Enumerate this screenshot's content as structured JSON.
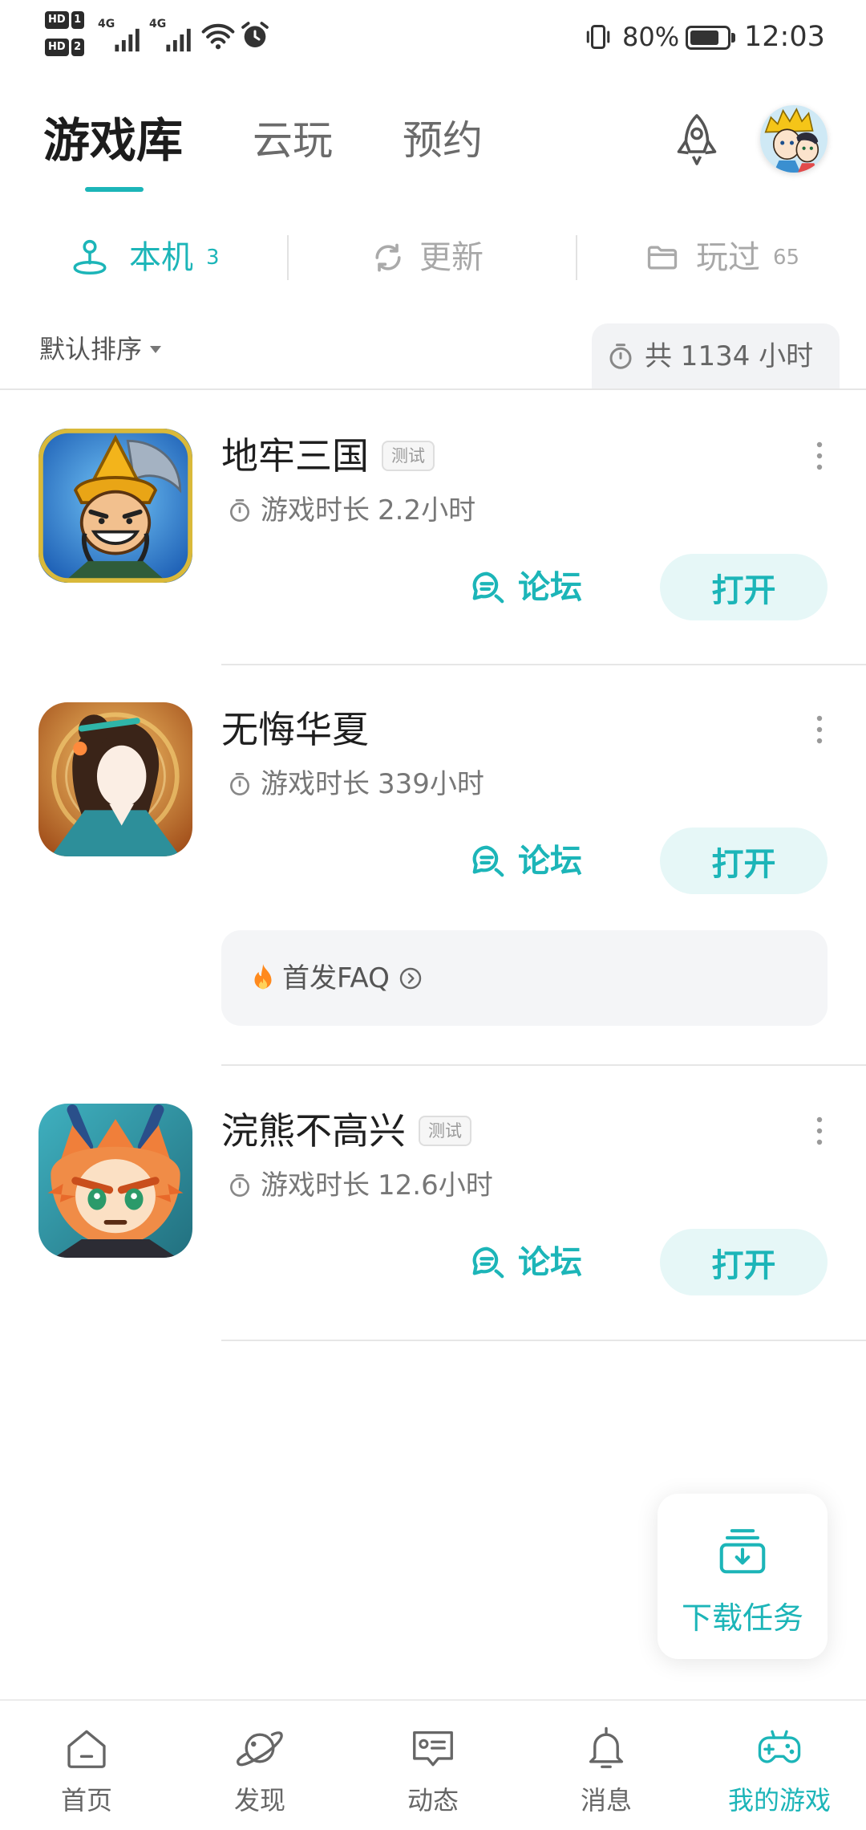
{
  "status_bar": {
    "sim_label": "HD",
    "sim_slots": [
      "1",
      "2"
    ],
    "network": [
      "4G",
      "4G"
    ],
    "battery": "80%",
    "battery_level": 0.8,
    "time": "12:03"
  },
  "header": {
    "tabs": [
      {
        "label": "游戏库",
        "active": true
      },
      {
        "label": "云玩",
        "active": false
      },
      {
        "label": "预约",
        "active": false
      }
    ],
    "action_icon": "rocket-icon"
  },
  "sub_tabs": [
    {
      "label": "本机",
      "count": "3",
      "icon": "joystick-icon",
      "active": true
    },
    {
      "label": "更新",
      "icon": "refresh-icon",
      "active": false
    },
    {
      "label": "玩过",
      "count": "65",
      "icon": "folder-icon",
      "active": false
    }
  ],
  "sort": {
    "label": "默认排序",
    "total_playtime": "共 1134 小时"
  },
  "games": [
    {
      "title": "地牢三国",
      "badge": "测试",
      "playtime_label": "游戏时长",
      "playtime": "2.2小时",
      "forum_label": "论坛",
      "open_label": "打开"
    },
    {
      "title": "无悔华夏",
      "playtime_label": "游戏时长",
      "playtime": "339小时",
      "forum_label": "论坛",
      "open_label": "打开",
      "faq_label": "首发FAQ"
    },
    {
      "title": "浣熊不高兴",
      "badge": "测试",
      "playtime_label": "游戏时长",
      "playtime": "12.6小时",
      "forum_label": "论坛",
      "open_label": "打开"
    }
  ],
  "download_task": {
    "label": "下载任务",
    "icon": "download-tray-icon"
  },
  "bottom_nav": [
    {
      "label": "首页",
      "icon": "home-icon",
      "active": false
    },
    {
      "label": "发现",
      "icon": "planet-icon",
      "active": false
    },
    {
      "label": "动态",
      "icon": "feed-icon",
      "active": false
    },
    {
      "label": "消息",
      "icon": "bell-icon",
      "active": false
    },
    {
      "label": "我的游戏",
      "icon": "gamepad-icon",
      "active": true
    }
  ],
  "colors": {
    "accent": "#1cb5b8",
    "open_button_bg": "#e6f7f7",
    "text": "#1f1f1f",
    "muted": "#999999",
    "divider": "#e6e6e6"
  }
}
